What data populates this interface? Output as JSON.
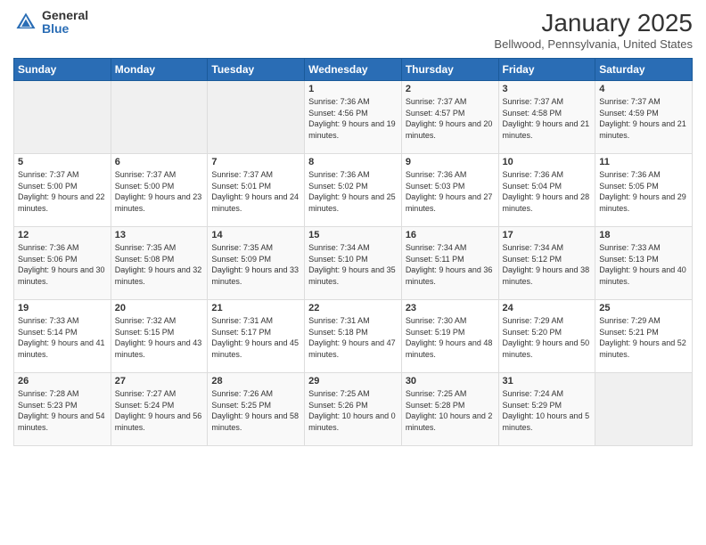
{
  "header": {
    "logo_general": "General",
    "logo_blue": "Blue",
    "month_title": "January 2025",
    "location": "Bellwood, Pennsylvania, United States"
  },
  "days_of_week": [
    "Sunday",
    "Monday",
    "Tuesday",
    "Wednesday",
    "Thursday",
    "Friday",
    "Saturday"
  ],
  "weeks": [
    [
      {
        "day": "",
        "sunrise": "",
        "sunset": "",
        "daylight": ""
      },
      {
        "day": "",
        "sunrise": "",
        "sunset": "",
        "daylight": ""
      },
      {
        "day": "",
        "sunrise": "",
        "sunset": "",
        "daylight": ""
      },
      {
        "day": "1",
        "sunrise": "Sunrise: 7:36 AM",
        "sunset": "Sunset: 4:56 PM",
        "daylight": "Daylight: 9 hours and 19 minutes."
      },
      {
        "day": "2",
        "sunrise": "Sunrise: 7:37 AM",
        "sunset": "Sunset: 4:57 PM",
        "daylight": "Daylight: 9 hours and 20 minutes."
      },
      {
        "day": "3",
        "sunrise": "Sunrise: 7:37 AM",
        "sunset": "Sunset: 4:58 PM",
        "daylight": "Daylight: 9 hours and 21 minutes."
      },
      {
        "day": "4",
        "sunrise": "Sunrise: 7:37 AM",
        "sunset": "Sunset: 4:59 PM",
        "daylight": "Daylight: 9 hours and 21 minutes."
      }
    ],
    [
      {
        "day": "5",
        "sunrise": "Sunrise: 7:37 AM",
        "sunset": "Sunset: 5:00 PM",
        "daylight": "Daylight: 9 hours and 22 minutes."
      },
      {
        "day": "6",
        "sunrise": "Sunrise: 7:37 AM",
        "sunset": "Sunset: 5:00 PM",
        "daylight": "Daylight: 9 hours and 23 minutes."
      },
      {
        "day": "7",
        "sunrise": "Sunrise: 7:37 AM",
        "sunset": "Sunset: 5:01 PM",
        "daylight": "Daylight: 9 hours and 24 minutes."
      },
      {
        "day": "8",
        "sunrise": "Sunrise: 7:36 AM",
        "sunset": "Sunset: 5:02 PM",
        "daylight": "Daylight: 9 hours and 25 minutes."
      },
      {
        "day": "9",
        "sunrise": "Sunrise: 7:36 AM",
        "sunset": "Sunset: 5:03 PM",
        "daylight": "Daylight: 9 hours and 27 minutes."
      },
      {
        "day": "10",
        "sunrise": "Sunrise: 7:36 AM",
        "sunset": "Sunset: 5:04 PM",
        "daylight": "Daylight: 9 hours and 28 minutes."
      },
      {
        "day": "11",
        "sunrise": "Sunrise: 7:36 AM",
        "sunset": "Sunset: 5:05 PM",
        "daylight": "Daylight: 9 hours and 29 minutes."
      }
    ],
    [
      {
        "day": "12",
        "sunrise": "Sunrise: 7:36 AM",
        "sunset": "Sunset: 5:06 PM",
        "daylight": "Daylight: 9 hours and 30 minutes."
      },
      {
        "day": "13",
        "sunrise": "Sunrise: 7:35 AM",
        "sunset": "Sunset: 5:08 PM",
        "daylight": "Daylight: 9 hours and 32 minutes."
      },
      {
        "day": "14",
        "sunrise": "Sunrise: 7:35 AM",
        "sunset": "Sunset: 5:09 PM",
        "daylight": "Daylight: 9 hours and 33 minutes."
      },
      {
        "day": "15",
        "sunrise": "Sunrise: 7:34 AM",
        "sunset": "Sunset: 5:10 PM",
        "daylight": "Daylight: 9 hours and 35 minutes."
      },
      {
        "day": "16",
        "sunrise": "Sunrise: 7:34 AM",
        "sunset": "Sunset: 5:11 PM",
        "daylight": "Daylight: 9 hours and 36 minutes."
      },
      {
        "day": "17",
        "sunrise": "Sunrise: 7:34 AM",
        "sunset": "Sunset: 5:12 PM",
        "daylight": "Daylight: 9 hours and 38 minutes."
      },
      {
        "day": "18",
        "sunrise": "Sunrise: 7:33 AM",
        "sunset": "Sunset: 5:13 PM",
        "daylight": "Daylight: 9 hours and 40 minutes."
      }
    ],
    [
      {
        "day": "19",
        "sunrise": "Sunrise: 7:33 AM",
        "sunset": "Sunset: 5:14 PM",
        "daylight": "Daylight: 9 hours and 41 minutes."
      },
      {
        "day": "20",
        "sunrise": "Sunrise: 7:32 AM",
        "sunset": "Sunset: 5:15 PM",
        "daylight": "Daylight: 9 hours and 43 minutes."
      },
      {
        "day": "21",
        "sunrise": "Sunrise: 7:31 AM",
        "sunset": "Sunset: 5:17 PM",
        "daylight": "Daylight: 9 hours and 45 minutes."
      },
      {
        "day": "22",
        "sunrise": "Sunrise: 7:31 AM",
        "sunset": "Sunset: 5:18 PM",
        "daylight": "Daylight: 9 hours and 47 minutes."
      },
      {
        "day": "23",
        "sunrise": "Sunrise: 7:30 AM",
        "sunset": "Sunset: 5:19 PM",
        "daylight": "Daylight: 9 hours and 48 minutes."
      },
      {
        "day": "24",
        "sunrise": "Sunrise: 7:29 AM",
        "sunset": "Sunset: 5:20 PM",
        "daylight": "Daylight: 9 hours and 50 minutes."
      },
      {
        "day": "25",
        "sunrise": "Sunrise: 7:29 AM",
        "sunset": "Sunset: 5:21 PM",
        "daylight": "Daylight: 9 hours and 52 minutes."
      }
    ],
    [
      {
        "day": "26",
        "sunrise": "Sunrise: 7:28 AM",
        "sunset": "Sunset: 5:23 PM",
        "daylight": "Daylight: 9 hours and 54 minutes."
      },
      {
        "day": "27",
        "sunrise": "Sunrise: 7:27 AM",
        "sunset": "Sunset: 5:24 PM",
        "daylight": "Daylight: 9 hours and 56 minutes."
      },
      {
        "day": "28",
        "sunrise": "Sunrise: 7:26 AM",
        "sunset": "Sunset: 5:25 PM",
        "daylight": "Daylight: 9 hours and 58 minutes."
      },
      {
        "day": "29",
        "sunrise": "Sunrise: 7:25 AM",
        "sunset": "Sunset: 5:26 PM",
        "daylight": "Daylight: 10 hours and 0 minutes."
      },
      {
        "day": "30",
        "sunrise": "Sunrise: 7:25 AM",
        "sunset": "Sunset: 5:28 PM",
        "daylight": "Daylight: 10 hours and 2 minutes."
      },
      {
        "day": "31",
        "sunrise": "Sunrise: 7:24 AM",
        "sunset": "Sunset: 5:29 PM",
        "daylight": "Daylight: 10 hours and 5 minutes."
      },
      {
        "day": "",
        "sunrise": "",
        "sunset": "",
        "daylight": ""
      }
    ]
  ]
}
